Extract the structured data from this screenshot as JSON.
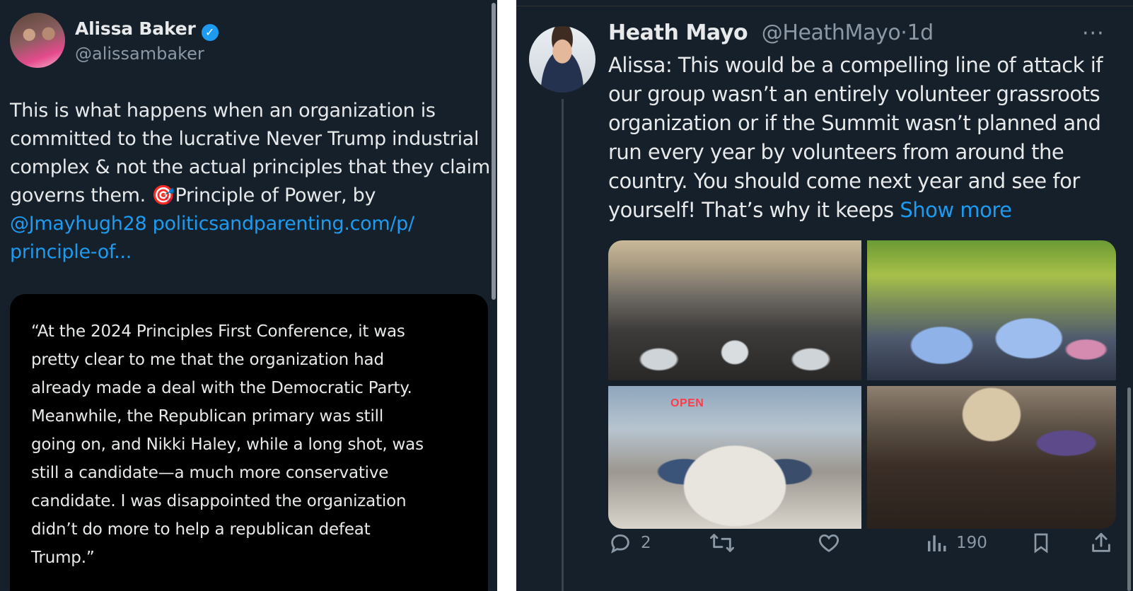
{
  "left_tweet": {
    "author": {
      "name": "Alissa Baker",
      "handle": "@alissambaker",
      "verified": true
    },
    "body": {
      "text": "This is what happens when an organization is committed to the lucrative Never Trump industrial complex & not the actual principles that they claim governs them. 🎯",
      "text_after_emoji": "Principle of Power, by",
      "mention": "@Jmayhugh28",
      "link_part1": "politicsandparenting.com/p/",
      "link_part2": "principle-of..."
    },
    "quote_card_text": "“At the 2024 Principles First Conference, it was\n  pretty clear to me that the organization had\n  already made a deal with the Democratic Party.\n  Meanwhile, the Republican primary was still\n  going on, and Nikki Haley, while a long shot, was\n  still a candidate—a much more conservative\n  candidate. I was disappointed the organization\n  didn’t do more to help a republican defeat\n  Trump.”"
  },
  "right_tweet": {
    "author": {
      "name": "Heath Mayo",
      "handle": "@HeathMayo",
      "separator": "·",
      "time": "1d"
    },
    "body": "Alissa: This would be a compelling line of attack if our group wasn’t an entirely volunteer grassroots organization or if the Summit wasn’t planned and run every year by volunteers from around the country. You should come next year and see for yourself! That’s why it keeps",
    "show_more": "Show more",
    "more_menu": "···",
    "media": [
      {
        "id": "photo-1",
        "subject": "banquet-hall-event"
      },
      {
        "id": "photo-2",
        "subject": "outdoor-crowd-blue-shirts"
      },
      {
        "id": "photo-3",
        "subject": "group-photo-storefront",
        "sign_text": "OPEN"
      },
      {
        "id": "photo-4",
        "subject": "conference-audience"
      }
    ],
    "actions": {
      "reply_count": "2",
      "retweet_count": "",
      "like_count": "",
      "views_count": "190"
    }
  },
  "colors": {
    "background": "#15202b",
    "quote_card": "#000000",
    "text_primary": "#e7e9ea",
    "text_secondary": "#8b98a5",
    "link": "#1d9bf0"
  }
}
